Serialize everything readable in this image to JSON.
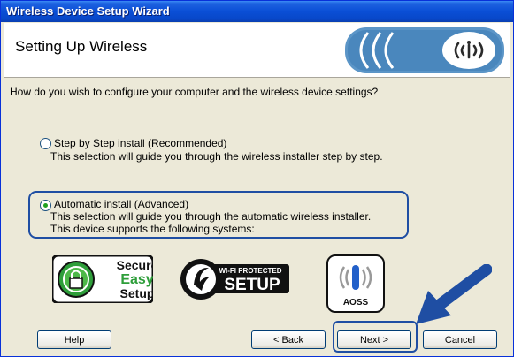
{
  "window": {
    "title": "Wireless Device Setup Wizard"
  },
  "header": {
    "title": "Setting Up Wireless"
  },
  "question": "How do you wish to configure your computer and the wireless device settings?",
  "options": [
    {
      "label": "Step by Step install (Recommended)",
      "description": "This selection will guide you through the wireless installer step by step.",
      "selected": false
    },
    {
      "label": "Automatic install (Advanced)",
      "description": "This selection will guide you through the automatic wireless installer.",
      "description2": "This device supports the following systems:",
      "selected": true
    }
  ],
  "logos": {
    "secure_easy_setup": [
      "Secure",
      "Easy",
      "Setup"
    ],
    "wifi_protected": {
      "small": "WI-FI PROTECTED",
      "big": "SETUP"
    },
    "aoss": "AOSS"
  },
  "buttons": {
    "help": "Help",
    "back": "< Back",
    "next": "Next >",
    "cancel": "Cancel"
  },
  "colors": {
    "title_bar": "#0a4fd6",
    "highlight": "#1f4ea3",
    "radio_dot": "#21a121",
    "secure_green": "#2e9e3a"
  }
}
